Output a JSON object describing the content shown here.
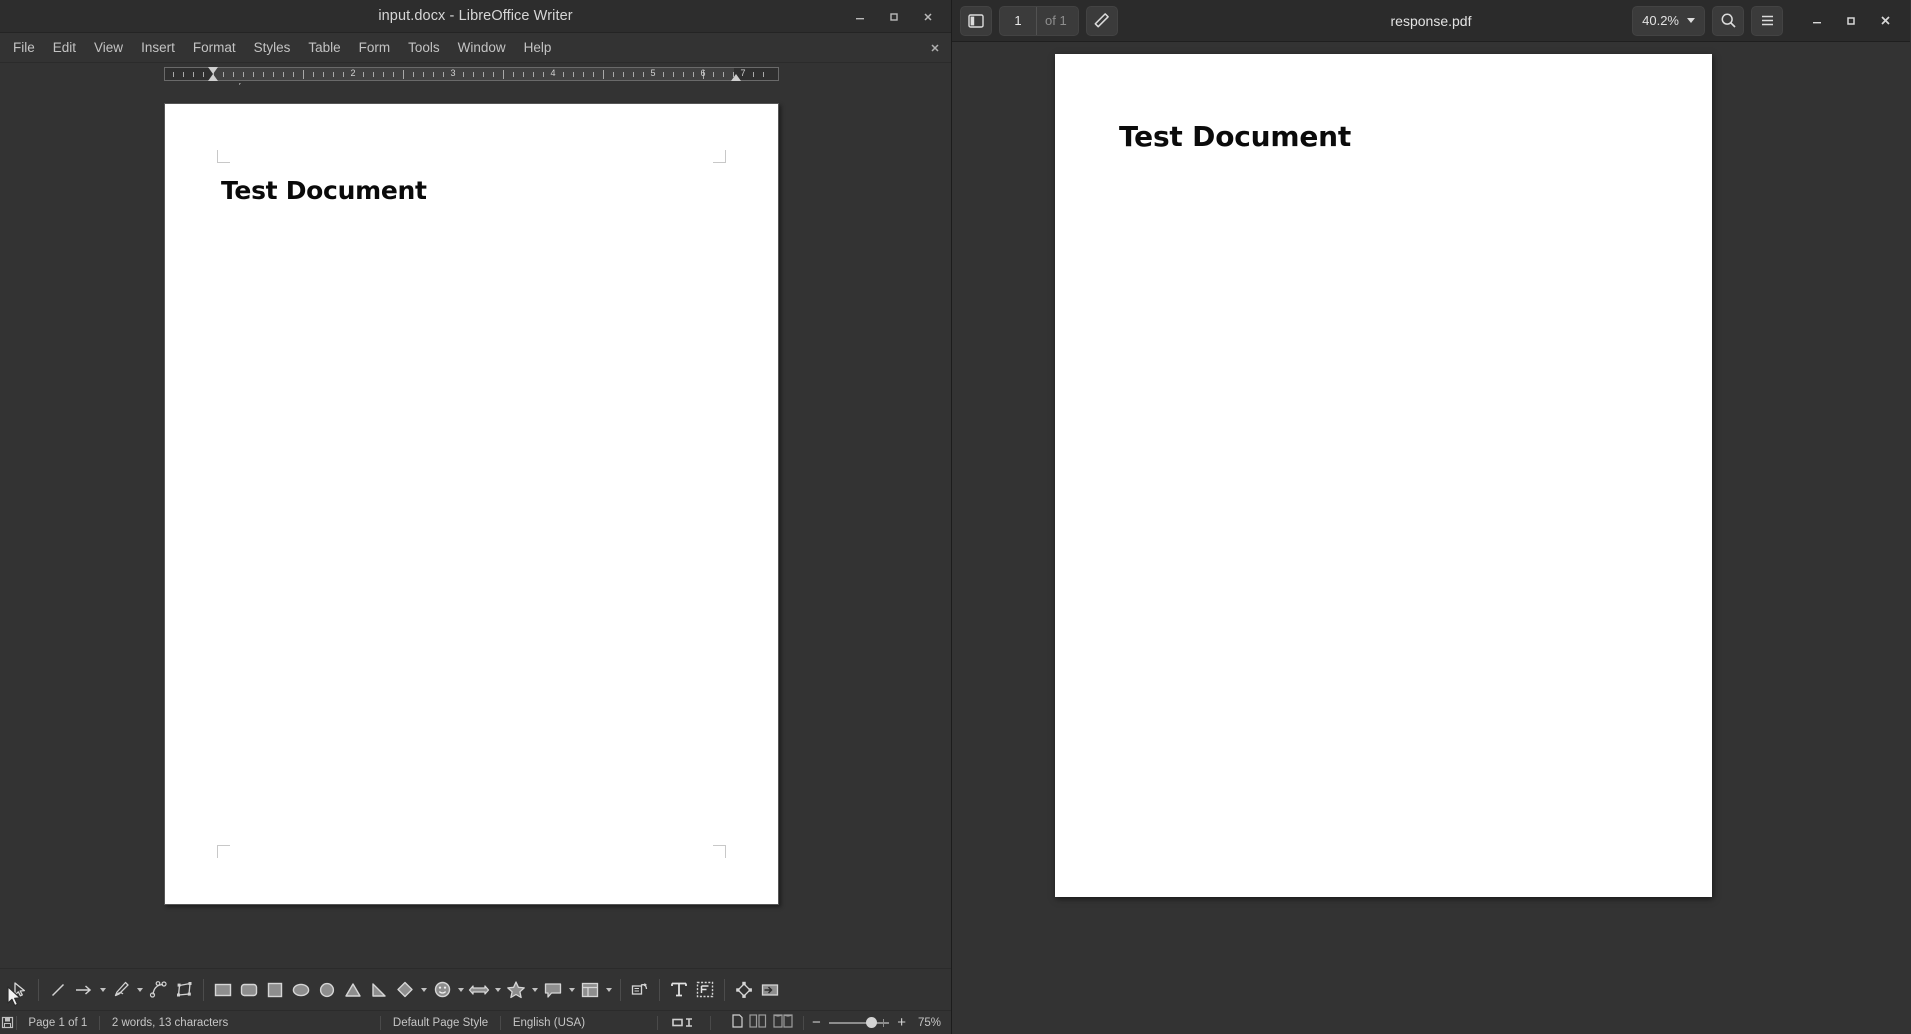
{
  "writer": {
    "title": "input.docx - LibreOffice Writer",
    "window_controls": [
      {
        "name": "minimize",
        "label": "–"
      },
      {
        "name": "maximize",
        "label": "▫"
      },
      {
        "name": "close",
        "label": "×"
      }
    ],
    "menus": [
      "File",
      "Edit",
      "View",
      "Insert",
      "Format",
      "Styles",
      "Table",
      "Form",
      "Tools",
      "Window",
      "Help"
    ],
    "document_close_label": "×",
    "ruler": {
      "numbers": [
        "2",
        "3",
        "4",
        "5",
        "6",
        "7"
      ],
      "unit": "inch"
    },
    "document": {
      "heading": "Test Document"
    },
    "drawing_tools": [
      {
        "name": "select-tool",
        "icon": "cursor-arrow-icon"
      },
      {
        "name": "line-tool",
        "icon": "line-icon"
      },
      {
        "name": "line-ends-with-arrow-tool",
        "icon": "arrow-icon",
        "dropdown": true
      },
      {
        "name": "freeform-line-tool",
        "icon": "pencil-freeform-icon",
        "dropdown": true
      },
      {
        "name": "curve-polygon-tool",
        "icon": "curve-points-icon"
      },
      {
        "name": "rotate-rectangle-tool",
        "icon": "rotate-rect-icon"
      },
      {
        "name": "rectangle-tool",
        "icon": "rectangle-icon"
      },
      {
        "name": "rounded-rectangle-tool",
        "icon": "rounded-rectangle-icon"
      },
      {
        "name": "square-tool",
        "icon": "filled-square-icon"
      },
      {
        "name": "ellipse-tool",
        "icon": "ellipse-icon"
      },
      {
        "name": "circle-tool",
        "icon": "circle-icon"
      },
      {
        "name": "isosceles-triangle-tool",
        "icon": "triangle-icon"
      },
      {
        "name": "right-triangle-tool",
        "icon": "right-triangle-icon"
      },
      {
        "name": "basic-shapes-tool",
        "icon": "diamond-icon",
        "dropdown": true
      },
      {
        "name": "symbol-shapes-tool",
        "icon": "smiley-icon",
        "dropdown": true
      },
      {
        "name": "block-arrows-tool",
        "icon": "double-arrow-icon",
        "dropdown": true
      },
      {
        "name": "stars-banners-tool",
        "icon": "star-icon",
        "dropdown": true
      },
      {
        "name": "callouts-tool",
        "icon": "callout-icon",
        "dropdown": true
      },
      {
        "name": "flowchart-tool",
        "icon": "flowchart-icon",
        "dropdown": true
      },
      {
        "name": "rotate-tool",
        "icon": "rotate-object-icon"
      },
      {
        "name": "insert-text-box-tool",
        "icon": "text-box-icon"
      },
      {
        "name": "vertical-text-tool",
        "icon": "text-frame-icon"
      },
      {
        "name": "edit-points-tool",
        "icon": "edit-points-icon"
      },
      {
        "name": "show-draw-functions-tool",
        "icon": "insert-from-file-icon"
      }
    ],
    "status": {
      "save_icon": "floppy-save-icon",
      "page": "Page 1 of 1",
      "word_count": "2 words, 13 characters",
      "page_style": "Default Page Style",
      "language": "English (USA)",
      "selection_mode_icon": "selection-mode-icon",
      "view_single_icon": "single-page-view-icon",
      "view_multi_icon": "multi-page-view-icon",
      "view_book_icon": "book-view-icon",
      "zoom_out_label": "−",
      "zoom_in_label": "+",
      "zoom_level": "75%"
    }
  },
  "pdf": {
    "title": "response.pdf",
    "sidebar_toggle_icon": "sidebar-toggle-icon",
    "page_current": "1",
    "page_total": "of 1",
    "annotate_icon": "pencil-annotate-icon",
    "zoom_level": "40.2%",
    "search_icon": "search-icon",
    "menu_icon": "hamburger-menu-icon",
    "window_controls": [
      {
        "name": "minimize",
        "label": "–"
      },
      {
        "name": "maximize",
        "label": "▫"
      },
      {
        "name": "close",
        "label": "×"
      }
    ],
    "document": {
      "heading": "Test Document"
    }
  },
  "colors": {
    "window_chrome": "#2d2d2d",
    "workspace": "#333333",
    "page": "#ffffff",
    "text_primary": "#d6d6d6",
    "text_muted": "#8e8e8e"
  }
}
